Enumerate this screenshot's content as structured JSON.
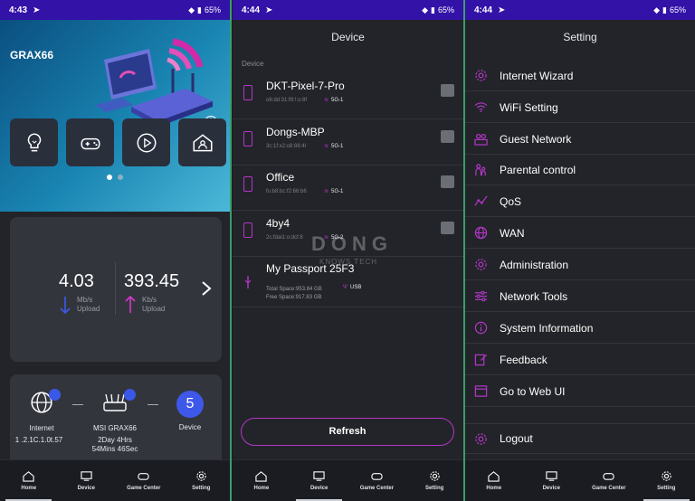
{
  "home": {
    "status": {
      "time": "4:43",
      "battery": "65%"
    },
    "brand": "GRAX66",
    "download": {
      "value": "4.03",
      "unit": "Mb/s",
      "direction": "Upload"
    },
    "upload": {
      "value": "393.45",
      "unit": "Kb/s",
      "direction": "Upload"
    },
    "internet": {
      "label": "Internet",
      "ip": "1 .2.1C.1.0t.57"
    },
    "router": {
      "label": "MSI GRAX66",
      "uptime_line1": "2Day 4Hrs",
      "uptime_line2": "54Mins 46Sec"
    },
    "device": {
      "count": "5",
      "label": "Device"
    },
    "active_tab": "Home"
  },
  "device_screen": {
    "status": {
      "time": "4:44",
      "battery": "65%"
    },
    "title": "Device",
    "section": "Device",
    "devices": [
      {
        "name": "DKT-Pixel-7-Pro",
        "mac": "o6:dd:31:f8:!:o:8f",
        "band": "5G-1"
      },
      {
        "name": "Dongs-MBP",
        "mac": "3c:1f:x2:o8:88:4l",
        "band": "5G-1"
      },
      {
        "name": "Office",
        "mac": "fu:b8:bc:f2:66:b6",
        "band": "5G-1"
      },
      {
        "name": "4by4",
        "mac": "2c:fdai1:o:dcf:8",
        "band": "5G-2"
      }
    ],
    "storage": {
      "name": "My Passport 25F3",
      "total": "Total Space:953.84 GB",
      "free": "Free Space:917.83 GB",
      "type": "USB"
    },
    "watermark_top": "DONG",
    "watermark_bottom": "KNOWS TECH",
    "refresh_label": "Refresh",
    "active_tab": "Device"
  },
  "setting_screen": {
    "status": {
      "time": "4:44",
      "battery": "65%"
    },
    "title": "Setting",
    "items": [
      "Internet Wizard",
      "WiFi Setting",
      "Guest Network",
      "Parental control",
      "QoS",
      "WAN",
      "Administration",
      "Network Tools",
      "System Information",
      "Feedback",
      "Go to Web UI",
      "Logout"
    ],
    "active_tab": "Setting"
  },
  "nav": {
    "home": "Home",
    "device": "Device",
    "game": "Game Center",
    "setting": "Setting"
  },
  "colors": {
    "accent": "#b336c8",
    "statusbar": "#3312a8",
    "blue": "#3e59e9",
    "panel": "#232429",
    "card": "#33353d"
  }
}
